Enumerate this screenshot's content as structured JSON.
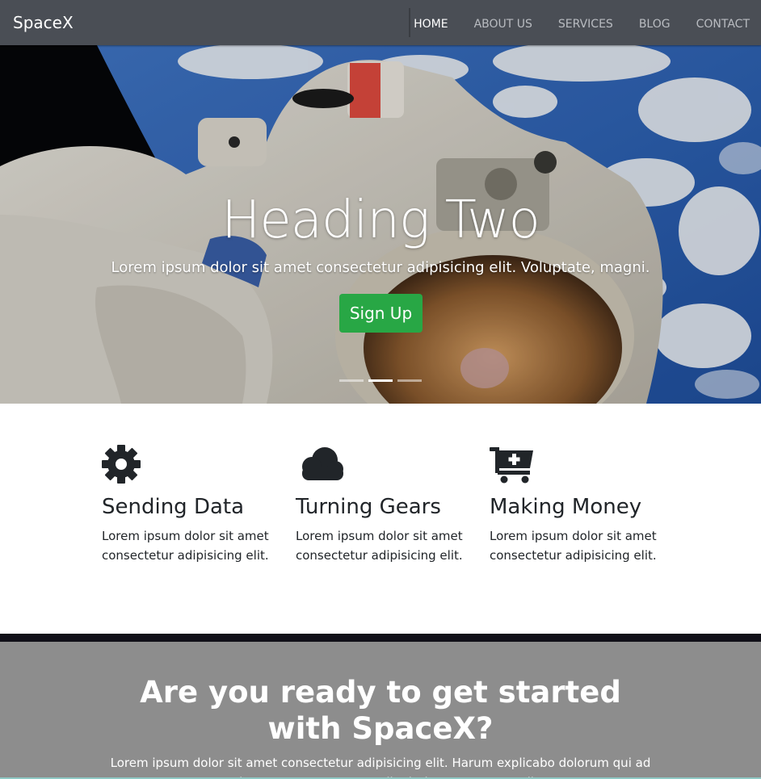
{
  "nav": {
    "brand": "SpaceX",
    "links": [
      {
        "label": "HOME",
        "active": true
      },
      {
        "label": "ABOUT US",
        "active": false
      },
      {
        "label": "SERVICES",
        "active": false
      },
      {
        "label": "BLOG",
        "active": false
      },
      {
        "label": "CONTACT",
        "active": false
      }
    ]
  },
  "hero": {
    "heading": "Heading Two",
    "text": "Lorem ipsum dolor sit amet consectetur adipisicing elit. Voluptate, magni.",
    "button_label": "Sign Up",
    "button_color": "#28a745",
    "slide_count": 3,
    "active_slide": 2
  },
  "features": [
    {
      "icon": "gear-icon",
      "title": "Sending Data",
      "text": "Lorem ipsum dolor sit amet consectetur adipisicing elit."
    },
    {
      "icon": "cloud-icon",
      "title": "Turning Gears",
      "text": "Lorem ipsum dolor sit amet consectetur adipisicing elit."
    },
    {
      "icon": "cart-plus-icon",
      "title": "Making Money",
      "text": "Lorem ipsum dolor sit amet consectetur adipisicing elit."
    }
  ],
  "cta": {
    "heading": "Are you ready to get started with SpaceX?",
    "text": "Lorem ipsum dolor sit amet consectetur adipisicing elit. Harum explicabo dolorum qui ad porro iure saepe consectetur dignissimos numquam dicta!"
  }
}
